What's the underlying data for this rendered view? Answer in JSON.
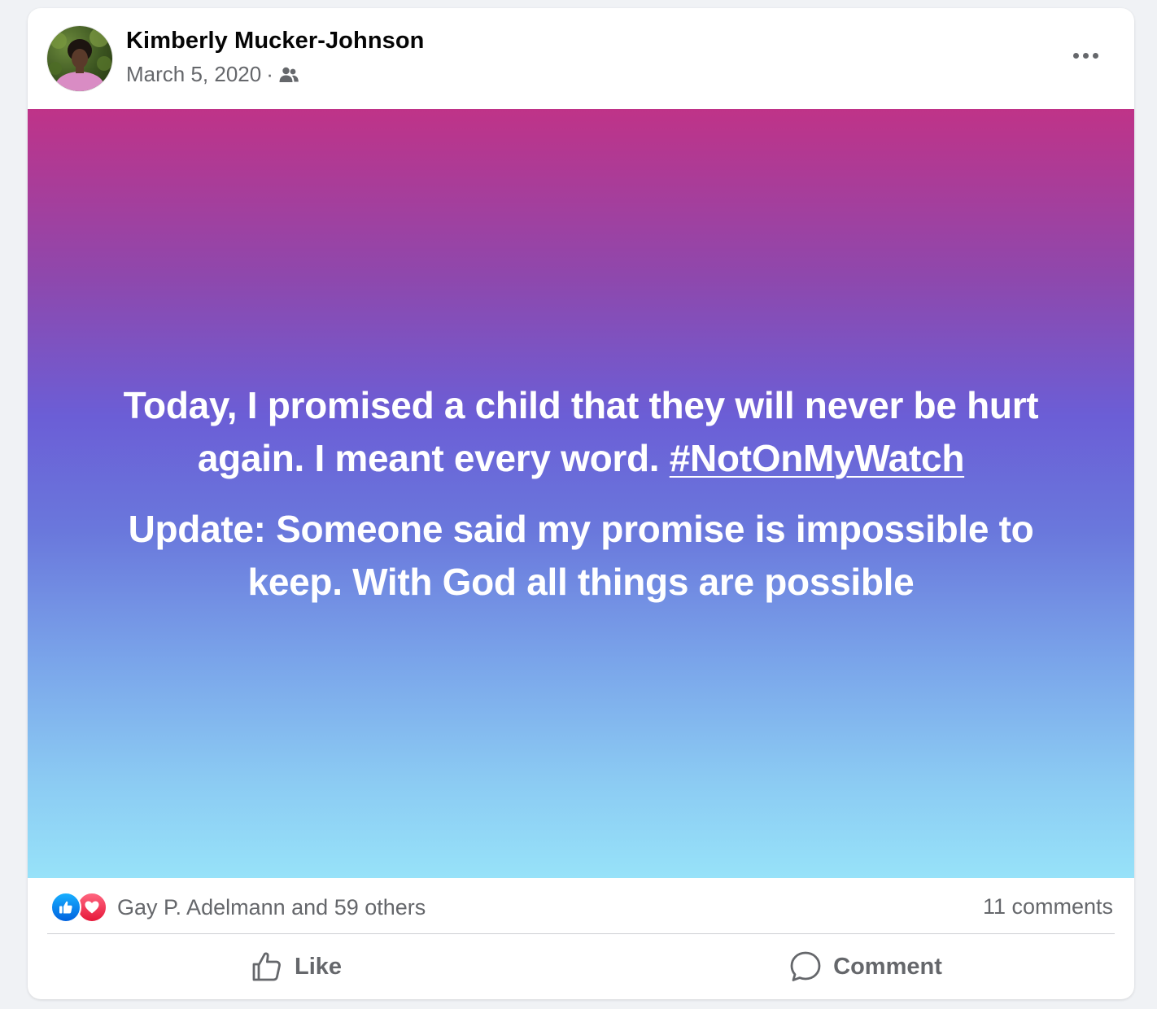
{
  "post": {
    "author": "Kimberly Mucker-Johnson",
    "date": "March 5, 2020",
    "separator": "·",
    "audience_icon": "friends-icon",
    "more_icon": "more-options-icon"
  },
  "content": {
    "line1_text": "Today, I promised a child that they will never be hurt again. I meant every word. ",
    "hashtag": "#NotOnMyWatch",
    "line2_text": "Update: Someone said my promise is impossible to keep. With God all things are possible",
    "background_gradient": [
      "#bf3388",
      "#8e48ad",
      "#6b5ed6",
      "#6a78dc",
      "#7aa5ea",
      "#8cccf3",
      "#97e2f9"
    ]
  },
  "stats": {
    "reaction_icons": [
      "like-reaction-icon",
      "love-reaction-icon"
    ],
    "reactors": "Gay P. Adelmann and 59 others",
    "comments": "11 comments"
  },
  "actions": {
    "like_label": "Like",
    "comment_label": "Comment"
  },
  "colors": {
    "like_blue": "#0866ff",
    "love_red": "#f33e58",
    "secondary_text": "#65676b",
    "primary_text": "#050505"
  }
}
